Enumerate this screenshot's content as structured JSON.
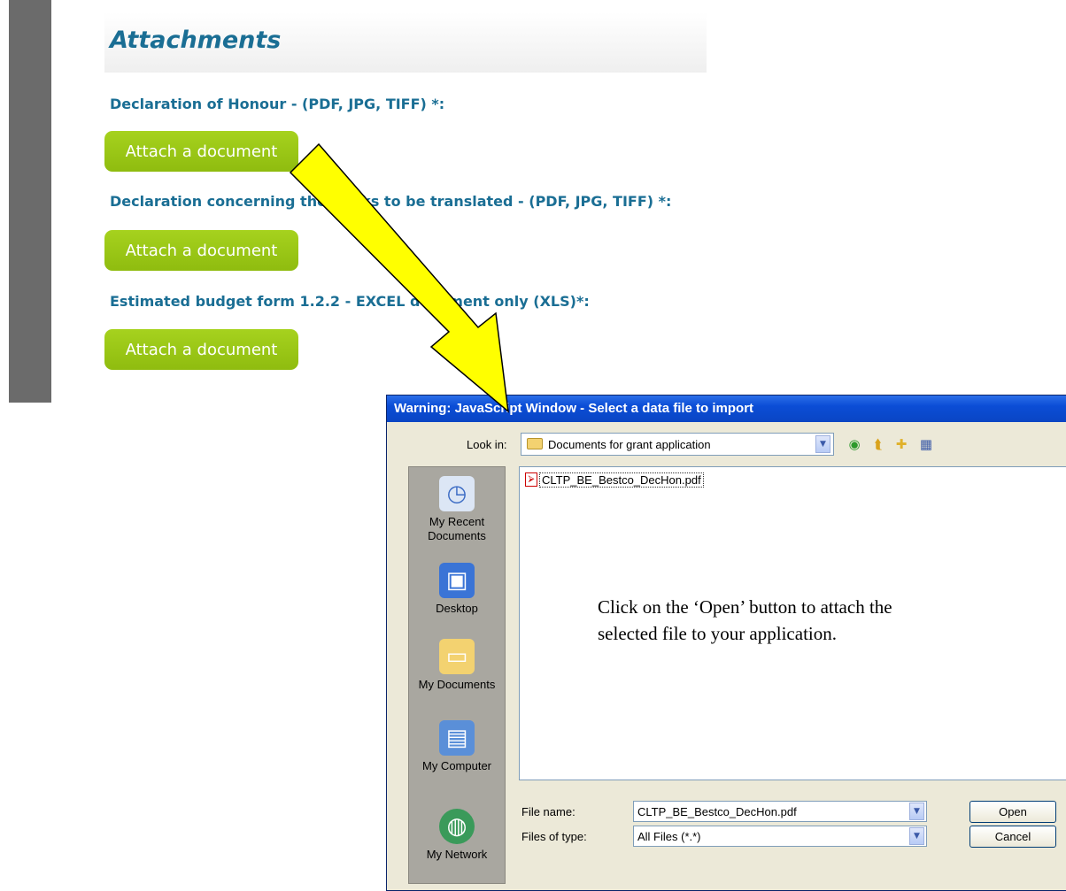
{
  "page": {
    "title": "Attachments",
    "fields": [
      {
        "label": "Declaration of Honour - (PDF, JPG, TIFF) *:",
        "button": "Attach a document"
      },
      {
        "label": "Declaration concerning the works to be translated - (PDF, JPG, TIFF) *:",
        "button": "Attach a document"
      },
      {
        "label": "Estimated budget form 1.2.2 - EXCEL document only (XLS)*:",
        "button": "Attach a document"
      }
    ]
  },
  "dialog": {
    "title": "Warning: JavaScript Window - Select a data file to import",
    "look_in_label": "Look in:",
    "look_in_value": "Documents for grant application",
    "places": [
      {
        "label": "My Recent Documents",
        "icon": "recent-documents-icon"
      },
      {
        "label": "Desktop",
        "icon": "desktop-icon"
      },
      {
        "label": "My Documents",
        "icon": "my-documents-icon"
      },
      {
        "label": "My Computer",
        "icon": "my-computer-icon"
      },
      {
        "label": "My Network",
        "icon": "my-network-icon"
      }
    ],
    "files": [
      {
        "name": "CLTP_BE_Bestco_DecHon.pdf",
        "icon": "pdf-icon"
      }
    ],
    "instruction": "Click on the ‘Open’ button to attach the selected file to your application.",
    "file_name_label": "File name:",
    "file_name_value": "CLTP_BE_Bestco_DecHon.pdf",
    "files_of_type_label": "Files of type:",
    "files_of_type_value": "All Files (*.*)",
    "open_button": "Open",
    "cancel_button": "Cancel"
  },
  "colors": {
    "heading": "#1a6e94",
    "attach_button": "#9bc715",
    "dialog_titlebar": "#0b4dd6",
    "arrow_fill": "#ffff00"
  }
}
